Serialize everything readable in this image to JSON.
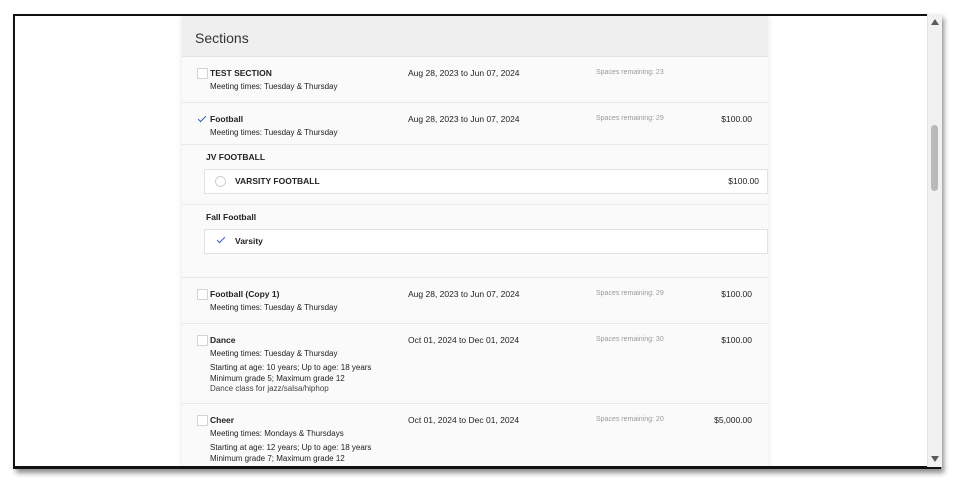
{
  "panel": {
    "title": "Sections"
  },
  "sections": [
    {
      "name": "TEST SECTION",
      "meeting": "Meeting times: Tuesday & Thursday",
      "dates": "Aug 28, 2023 to Jun 07, 2024",
      "spaces": "Spaces remaining: 23",
      "price": "",
      "checked": false
    },
    {
      "name": "Football",
      "meeting": "Meeting times: Tuesday & Thursday",
      "dates": "Aug 28, 2023 to Jun 07, 2024",
      "spaces": "Spaces remaining: 29",
      "price": "$100.00",
      "checked": true,
      "groups": [
        {
          "label": "JV FOOTBALL",
          "option": {
            "label": "VARSITY FOOTBALL",
            "price": "$100.00",
            "selected": false
          }
        },
        {
          "label": "Fall Football",
          "option": {
            "label": "Varsity",
            "price": "",
            "selected": true
          }
        }
      ]
    },
    {
      "name": "Football (Copy 1)",
      "meeting": "Meeting times: Tuesday & Thursday",
      "dates": "Aug 28, 2023 to Jun 07, 2024",
      "spaces": "Spaces remaining: 29",
      "price": "$100.00",
      "checked": false
    },
    {
      "name": "Dance",
      "meeting": "Meeting times: Tuesday & Thursday",
      "ages": "Starting at age: 10 years; Up to age: 18 years",
      "grades": "Minimum grade 5; Maximum grade 12",
      "description": "Dance class for jazz/salsa/hiphop",
      "dates": "Oct 01, 2024 to Dec 01, 2024",
      "spaces": "Spaces remaining: 30",
      "price": "$100.00",
      "checked": false
    },
    {
      "name": "Cheer",
      "meeting": "Meeting times: Mondays & Thursdays",
      "ages": "Starting at age: 12 years; Up to age: 18 years",
      "grades": "Minimum grade 7; Maximum grade 12",
      "dates": "Oct 01, 2024 to Dec 01, 2024",
      "spaces": "Spaces remaining: 20",
      "price": "$5,000.00",
      "checked": false
    }
  ],
  "colors": {
    "check": "#2d5ac8",
    "header_bg": "#efefef",
    "card_bg": "#fafafa"
  }
}
